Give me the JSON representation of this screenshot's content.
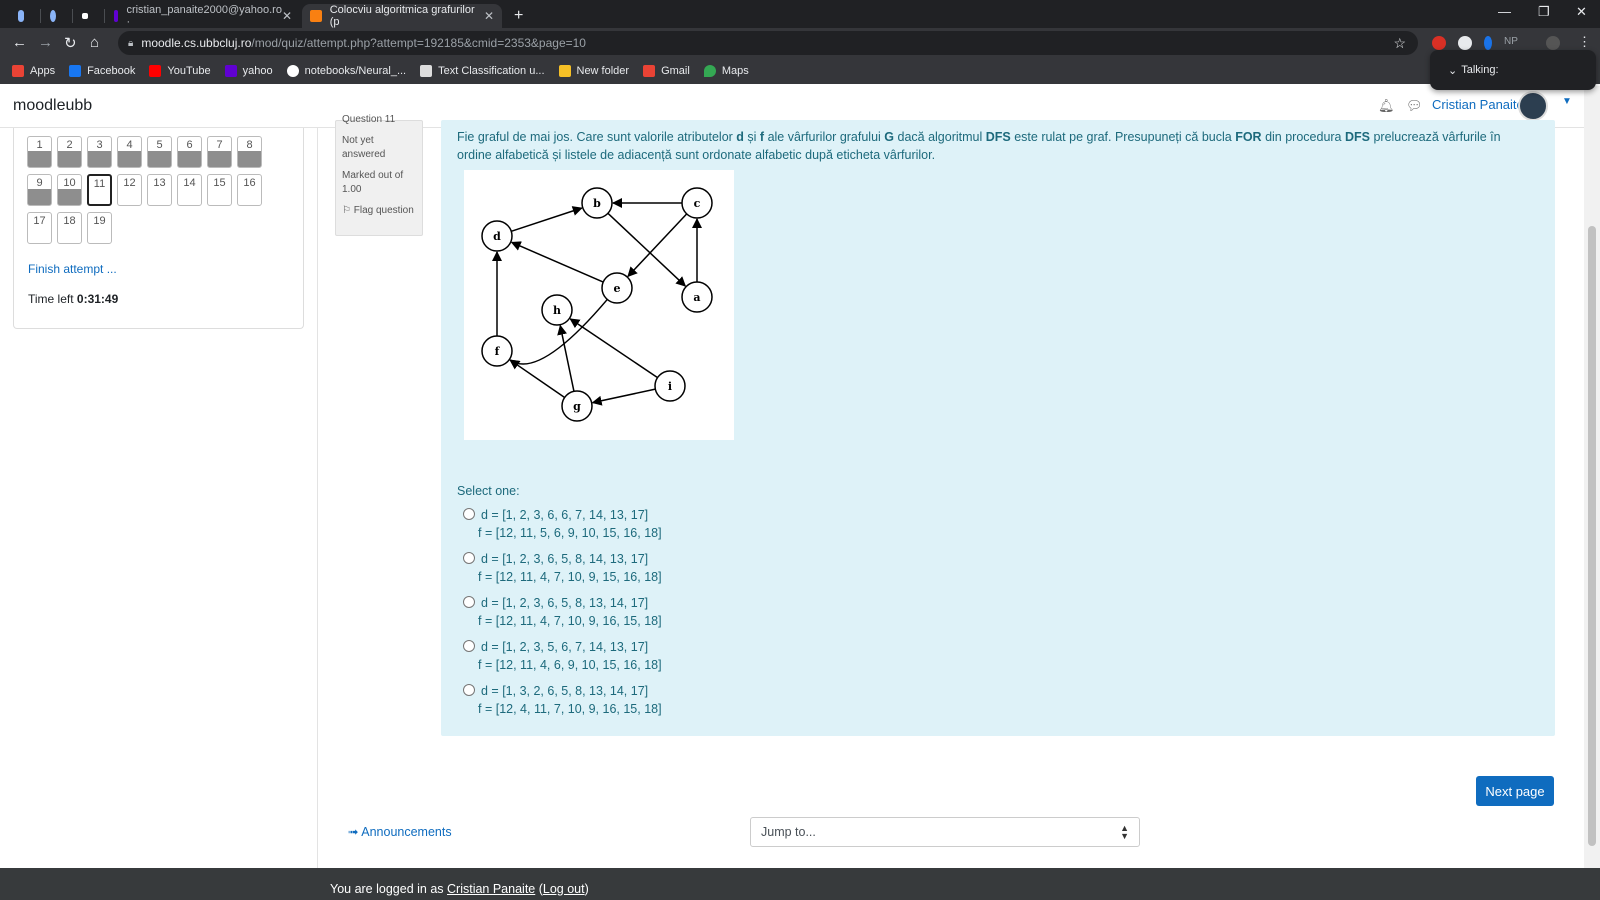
{
  "browser": {
    "tabs": [
      {
        "title": "",
        "fav_color": "#8ab4f8"
      },
      {
        "title": "",
        "fav_color": "#8ab4f8"
      },
      {
        "title": "",
        "fav_color": "#ffffff"
      },
      {
        "title": "cristian_panaite2000@yahoo.ro ·",
        "fav_color": "#6001d2"
      },
      {
        "title": "Colocviu algoritmica grafurilor (p",
        "fav_color": "#f98012"
      }
    ],
    "new_tab": "+",
    "url_host": "moodle.cs.ubbcluj.ro",
    "url_path": "/mod/quiz/attempt.php?attempt=192185&cmid=2353&page=10",
    "ext_label": "NP",
    "bookmarks": [
      {
        "label": "Apps",
        "color": "#ea4335"
      },
      {
        "label": "Facebook",
        "color": "#1877f2"
      },
      {
        "label": "YouTube",
        "color": "#ff0000"
      },
      {
        "label": "yahoo",
        "color": "#6001d2"
      },
      {
        "label": "notebooks/Neural_...",
        "color": "#ffffff"
      },
      {
        "label": "Text Classification u...",
        "color": "#dddddd"
      },
      {
        "label": "New folder",
        "color": "#f6c026"
      },
      {
        "label": "Gmail",
        "color": "#ea4335"
      },
      {
        "label": "Maps",
        "color": "#34a853"
      }
    ],
    "talking": "Talking:"
  },
  "navbar": {
    "brand": "moodleubb",
    "user": "Cristian Panaite"
  },
  "quiz_nav": {
    "buttons": [
      "1",
      "2",
      "3",
      "4",
      "5",
      "6",
      "7",
      "8",
      "9",
      "10",
      "11",
      "12",
      "13",
      "14",
      "15",
      "16",
      "17",
      "18",
      "19"
    ],
    "answered_count": 10,
    "current": "11",
    "finish": "Finish attempt ...",
    "time_label": "Time left",
    "time_value": "0:31:49"
  },
  "question_info": {
    "number_label": "Question 11",
    "status": "Not yet answered",
    "marked": "Marked out of 1.00",
    "flag": "Flag question"
  },
  "question": {
    "text_parts": [
      "Fie graful de mai jos. Care sunt valorile atributelor ",
      "d",
      " și ",
      "f",
      " ale vârfurilor grafului ",
      "G",
      " dacă algoritmul ",
      "DFS",
      " este rulat pe graf. Presupuneți că bucla ",
      "FOR",
      " din procedura ",
      "DFS",
      " prelucrează vârfurile în ordine alfabetică și listele de adiacență sunt ordonate alfabetic după eticheta vârfurilor."
    ],
    "select_one": "Select one:",
    "options": [
      {
        "d": "d = [1, 2, 3, 6, 6, 7, 14, 13, 17]",
        "f": "f = [12, 11, 5, 6, 9, 10, 15, 16, 18]"
      },
      {
        "d": "d = [1, 2, 3, 6, 5, 8, 14, 13, 17]",
        "f": "f = [12, 11, 4, 7, 10, 9, 15, 16, 18]"
      },
      {
        "d": "d = [1, 2, 3, 6, 5, 8, 13, 14, 17]",
        "f": "f = [12, 11, 4, 7, 10, 9, 16, 15, 18]"
      },
      {
        "d": "d = [1, 2, 3, 5, 6, 7, 14, 13, 17]",
        "f": "f = [12, 11, 4, 6, 9, 10, 15, 16, 18]"
      },
      {
        "d": "d = [1, 3, 2, 6, 5, 8, 13, 14, 17]",
        "f": "f = [12, 4, 11, 7, 10, 9, 16, 15, 18]"
      }
    ]
  },
  "graph": {
    "nodes": [
      "a",
      "b",
      "c",
      "d",
      "e",
      "f",
      "g",
      "h",
      "i"
    ],
    "edges": [
      [
        "c",
        "b"
      ],
      [
        "b",
        "a"
      ],
      [
        "a",
        "c"
      ],
      [
        "c",
        "e"
      ],
      [
        "d",
        "b"
      ],
      [
        "e",
        "d"
      ],
      [
        "f",
        "d"
      ],
      [
        "e",
        "f"
      ],
      [
        "g",
        "f"
      ],
      [
        "g",
        "h"
      ],
      [
        "i",
        "h"
      ],
      [
        "i",
        "g"
      ]
    ]
  },
  "actions": {
    "next": "Next page",
    "announcements": "➟ Announcements",
    "jump": "Jump to..."
  },
  "footer": {
    "prefix": "You are logged in as ",
    "user": "Cristian Panaite",
    "open": " (",
    "logout": "Log out",
    "close": ")"
  }
}
